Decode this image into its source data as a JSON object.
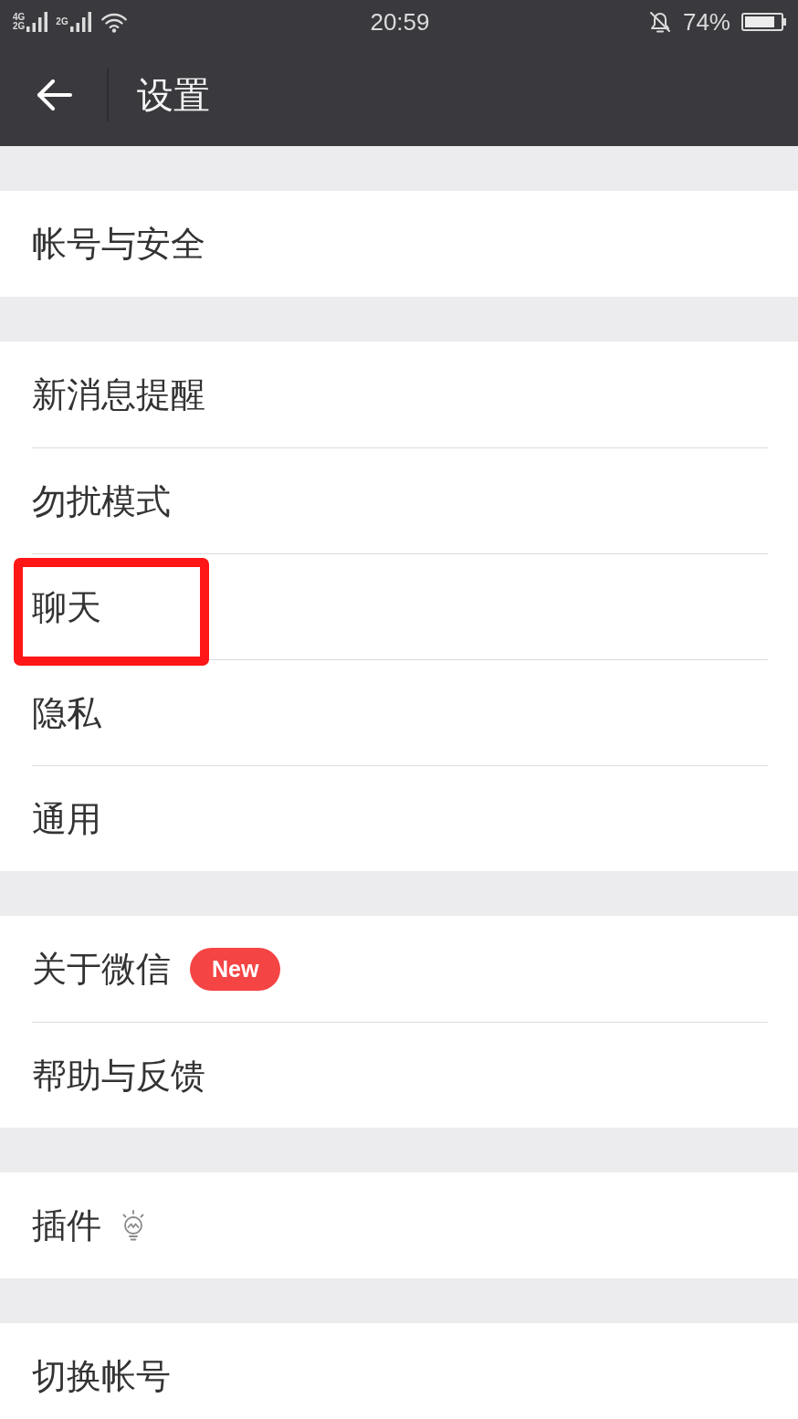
{
  "status_bar": {
    "sim_1": {
      "labels": [
        "4G",
        "2G"
      ]
    },
    "sim_2": {
      "labels": [
        "2G"
      ]
    },
    "time": "20:59",
    "muted": true,
    "battery": "74%"
  },
  "header": {
    "title": "设置"
  },
  "groups": [
    {
      "items": [
        {
          "label": "帐号与安全",
          "kind": "plain",
          "highlighted": false
        }
      ]
    },
    {
      "items": [
        {
          "label": "新消息提醒",
          "kind": "plain",
          "highlighted": false
        },
        {
          "label": "勿扰模式",
          "kind": "plain",
          "highlighted": false
        },
        {
          "label": "聊天",
          "kind": "plain",
          "highlighted": true
        },
        {
          "label": "隐私",
          "kind": "plain",
          "highlighted": false
        },
        {
          "label": "通用",
          "kind": "plain",
          "highlighted": false
        }
      ]
    },
    {
      "items": [
        {
          "label": "关于微信",
          "kind": "badge",
          "badge": "New",
          "highlighted": false
        },
        {
          "label": "帮助与反馈",
          "kind": "plain",
          "highlighted": false
        }
      ]
    },
    {
      "items": [
        {
          "label": "插件",
          "kind": "icon",
          "highlighted": false
        }
      ]
    },
    {
      "items": [
        {
          "label": "切换帐号",
          "kind": "plain",
          "highlighted": false
        }
      ]
    }
  ]
}
